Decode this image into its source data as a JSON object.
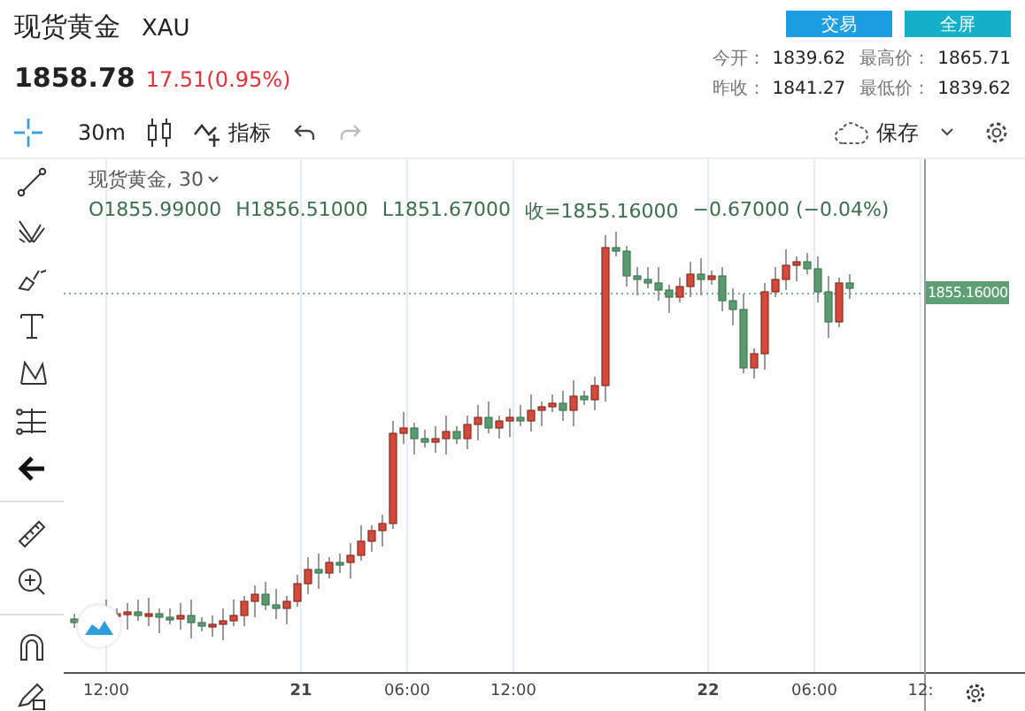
{
  "header": {
    "title": "现货黄金",
    "symbol": "XAU",
    "price": "1858.78",
    "change": "17.51(0.95%)",
    "buttons": [
      {
        "label": "交易",
        "color": "#1d9de2"
      },
      {
        "label": "全屏",
        "color": "#15b0c8"
      }
    ],
    "stats": [
      [
        {
          "label": "今开：",
          "value": "1839.62"
        },
        {
          "label": "最高价：",
          "value": "1865.71"
        }
      ],
      [
        {
          "label": "昨收：",
          "value": "1841.27"
        },
        {
          "label": "最低价：",
          "value": "1839.62"
        }
      ]
    ]
  },
  "toolbar": {
    "interval": "30m",
    "indicators": "指标",
    "save": "保存"
  },
  "legend": {
    "title": "现货黄金, 30",
    "open": "O1855.99000",
    "high": "H1856.51000",
    "low": "L1851.67000",
    "close": "收=1855.16000",
    "change": "−0.67000 (−0.04%)"
  },
  "price_label": "1855.16000",
  "time_axis": [
    {
      "label": "12:00",
      "bold": false
    },
    {
      "label": "21",
      "bold": true
    },
    {
      "label": "06:00",
      "bold": false
    },
    {
      "label": "12:00",
      "bold": false
    },
    {
      "label": "22",
      "bold": true
    },
    {
      "label": "06:00",
      "bold": false
    },
    {
      "label": "12:",
      "bold": false
    }
  ]
}
